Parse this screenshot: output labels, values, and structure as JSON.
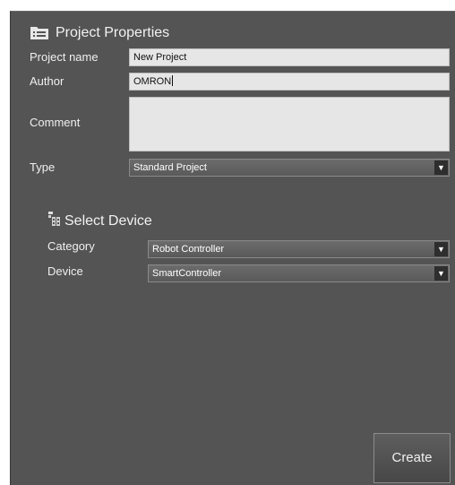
{
  "project_properties": {
    "title": "Project Properties",
    "icon": "list-document-icon",
    "project_name": {
      "label": "Project name",
      "value": "New Project"
    },
    "author": {
      "label": "Author",
      "value": "OMRON"
    },
    "comment": {
      "label": "Comment",
      "value": ""
    },
    "type": {
      "label": "Type",
      "selected": "Standard Project"
    }
  },
  "select_device": {
    "title": "Select Device",
    "icon": "device-tree-icon",
    "category": {
      "label": "Category",
      "selected": "Robot Controller"
    },
    "device": {
      "label": "Device",
      "selected": "SmartController"
    }
  },
  "actions": {
    "create_label": "Create"
  },
  "colors": {
    "panel_background": "#545454",
    "field_background": "#e6e6e6",
    "dropdown_background": "#626262",
    "dropdown_arrow_background": "#2e2e2e"
  }
}
